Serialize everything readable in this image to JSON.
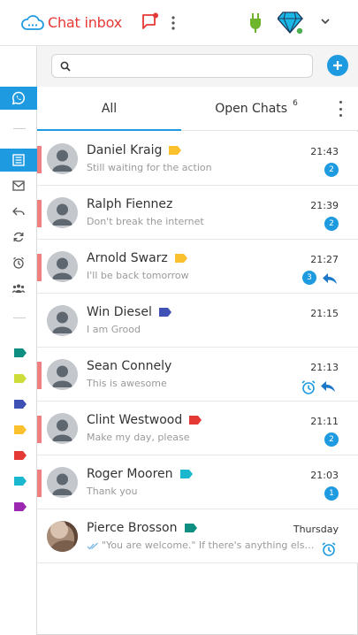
{
  "header": {
    "logo_text": "Chat inbox",
    "accent": "#e53935"
  },
  "search": {
    "placeholder": "",
    "value": ""
  },
  "tabs": [
    {
      "label": "All",
      "active": true
    },
    {
      "label": "Open Chats",
      "count": "6",
      "active": false
    }
  ],
  "sidebar": {
    "items": [
      {
        "icon": "whatsapp-icon",
        "active": true
      },
      {
        "icon": "inbox-icon",
        "active": true
      },
      {
        "icon": "mail-icon",
        "active": false
      },
      {
        "icon": "reply-icon",
        "active": false
      },
      {
        "icon": "refresh-icon",
        "active": false
      },
      {
        "icon": "alarm-icon",
        "active": false
      },
      {
        "icon": "team-icon",
        "active": false
      }
    ],
    "tags": [
      "#0f8f82",
      "#cddc39",
      "#3f51b5",
      "#fbc02d",
      "#e53935",
      "#1ab8cf",
      "#9c27b0"
    ]
  },
  "chats": [
    {
      "name": "Daniel Kraig",
      "preview": "Still waiting for the action",
      "time": "21:43",
      "unread": "2",
      "tag_color": "#fbc02d",
      "has_bar": true,
      "reply": false,
      "alarm": false
    },
    {
      "name": "Ralph Fiennez",
      "preview": "Don't break the internet",
      "time": "21:39",
      "unread": "2",
      "tag_color": "",
      "has_bar": true,
      "reply": false,
      "alarm": false
    },
    {
      "name": "Arnold Swarz",
      "preview": "I'll be back tomorrow",
      "time": "21:27",
      "unread": "3",
      "tag_color": "#fbc02d",
      "has_bar": true,
      "reply": true,
      "alarm": false
    },
    {
      "name": "Win Diesel",
      "preview": "I am Grood",
      "time": "21:15",
      "unread": "",
      "tag_color": "#3f51b5",
      "has_bar": false,
      "reply": false,
      "alarm": false
    },
    {
      "name": "Sean Connely",
      "preview": "This is awesome",
      "time": "21:13",
      "unread": "",
      "tag_color": "",
      "has_bar": true,
      "reply": true,
      "alarm": true
    },
    {
      "name": "Clint Westwood",
      "preview": "Make my day, please",
      "time": "21:11",
      "unread": "2",
      "tag_color": "#e53935",
      "has_bar": true,
      "reply": false,
      "alarm": false
    },
    {
      "name": "Roger Mooren",
      "preview": "Thank you",
      "time": "21:03",
      "unread": "1",
      "tag_color": "#1ab8cf",
      "has_bar": true,
      "reply": false,
      "alarm": false
    },
    {
      "name": "Pierce Brosson",
      "preview": "\"You are welcome.\" If there's anything else I ca...",
      "time": "Thursday",
      "unread": "",
      "tag_color": "#0f8f82",
      "has_bar": false,
      "reply": false,
      "alarm": true,
      "photo": true,
      "read_ticks": true
    }
  ]
}
